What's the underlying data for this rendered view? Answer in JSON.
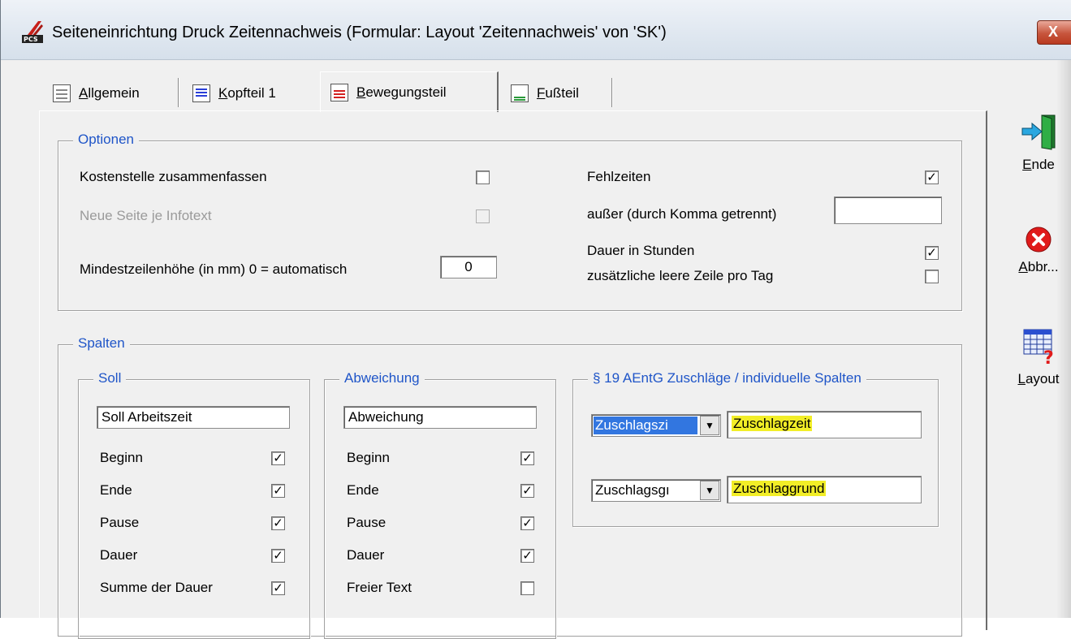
{
  "window": {
    "title": "Seiteneinrichtung Druck Zeitennachweis    (Formular: Layout 'Zeitennachweis' von 'SK')",
    "logo_text": "PCS",
    "close_label": "X"
  },
  "tabs": [
    {
      "label": "Allgemein",
      "accel": "A",
      "rest": "llgemein",
      "icon": "page-lines-icon"
    },
    {
      "label": "Kopfteil 1",
      "accel": "K",
      "rest": "opfteil 1",
      "icon": "header-blue-icon"
    },
    {
      "label": "Bewegungsteil",
      "accel": "B",
      "rest": "ewegungsteil",
      "icon": "body-red-icon",
      "active": true
    },
    {
      "label": "Fußteil",
      "accel": "F",
      "rest": "ußteil",
      "icon": "footer-green-icon"
    }
  ],
  "optionen": {
    "title": "Optionen",
    "kostenstelle": {
      "label": "Kostenstelle zusammenfassen",
      "checked": false
    },
    "neue_seite": {
      "label": "Neue Seite je Infotext",
      "checked": false,
      "disabled": true
    },
    "mindestzeile": {
      "label": "Mindestzeilenhöhe (in mm) 0 = automatisch",
      "value": "0"
    },
    "fehlzeiten": {
      "label": "Fehlzeiten",
      "checked": true,
      "mark": "✓"
    },
    "ausser": {
      "label": "außer (durch Komma getrennt)",
      "value": ""
    },
    "dauer_stunden": {
      "label": "Dauer in Stunden",
      "checked": true,
      "mark": "✓"
    },
    "leere_zeile": {
      "label": "zusätzliche leere Zeile pro Tag",
      "checked": false
    }
  },
  "spalten": {
    "title": "Spalten",
    "soll": {
      "title": "Soll",
      "field_value": "Soll Arbeitszeit",
      "rows": [
        {
          "label": "Beginn",
          "checked": true,
          "mark": "✓"
        },
        {
          "label": "Ende",
          "checked": true,
          "mark": "✓"
        },
        {
          "label": "Pause",
          "checked": true,
          "mark": "✓"
        },
        {
          "label": "Dauer",
          "checked": true,
          "mark": "✓"
        },
        {
          "label": "Summe der Dauer",
          "checked": true,
          "mark": "✓"
        }
      ]
    },
    "abweichung": {
      "title": "Abweichung",
      "field_value": "Abweichung",
      "rows": [
        {
          "label": "Beginn",
          "checked": true,
          "mark": "✓"
        },
        {
          "label": "Ende",
          "checked": true,
          "mark": "✓"
        },
        {
          "label": "Pause",
          "checked": true,
          "mark": "✓"
        },
        {
          "label": "Dauer",
          "checked": true,
          "mark": "✓"
        },
        {
          "label": "Freier Text",
          "checked": false,
          "mark": ""
        }
      ]
    },
    "zuschlaege": {
      "title": "§ 19 AEntG Zuschläge / individuelle Spalten",
      "row1": {
        "combo": "Zuschlagszi",
        "text": "Zuschlagzeit"
      },
      "row2": {
        "combo": "Zuschlagsgı",
        "text": "Zuschlaggrund"
      }
    }
  },
  "side_buttons": {
    "ende": {
      "label": "Ende",
      "accel": "E",
      "rest": "nde"
    },
    "abbr": {
      "label": "Abbr...",
      "accel": "A",
      "rest": "bbr..."
    },
    "layout": {
      "label": "Layout",
      "accel": "L",
      "rest": "ayout"
    }
  }
}
